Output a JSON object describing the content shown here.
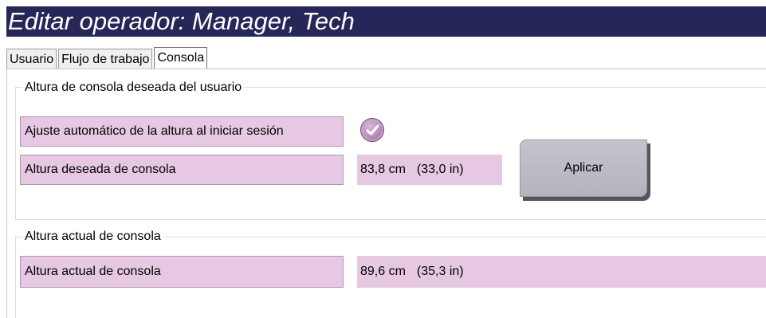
{
  "title": "Editar operador: Manager, Tech",
  "tabs": [
    {
      "label": "Usuario",
      "active": false
    },
    {
      "label": "Flujo de trabajo",
      "active": false
    },
    {
      "label": "Consola",
      "active": true
    }
  ],
  "desired_group": {
    "legend": "Altura de consola deseada del usuario",
    "auto_adjust_label": "Ajuste automático de la altura al iniciar sesión",
    "auto_adjust_checked": true,
    "desired_height_label": "Altura deseada de consola",
    "desired_height_cm": "83,8 cm",
    "desired_height_in": "(33,0 in)",
    "apply_button": "Aplicar"
  },
  "current_group": {
    "legend": "Altura actual de consola",
    "current_height_label": "Altura actual de consola",
    "current_height_cm": "89,6 cm",
    "current_height_in": "(35,3 in)"
  },
  "colors": {
    "title_bar": "#262659",
    "field_bg": "#e6c8e2",
    "checkbox": "#b88ab8",
    "button": "#bdbdc5"
  },
  "icons": {
    "checkbox": "check-icon"
  }
}
